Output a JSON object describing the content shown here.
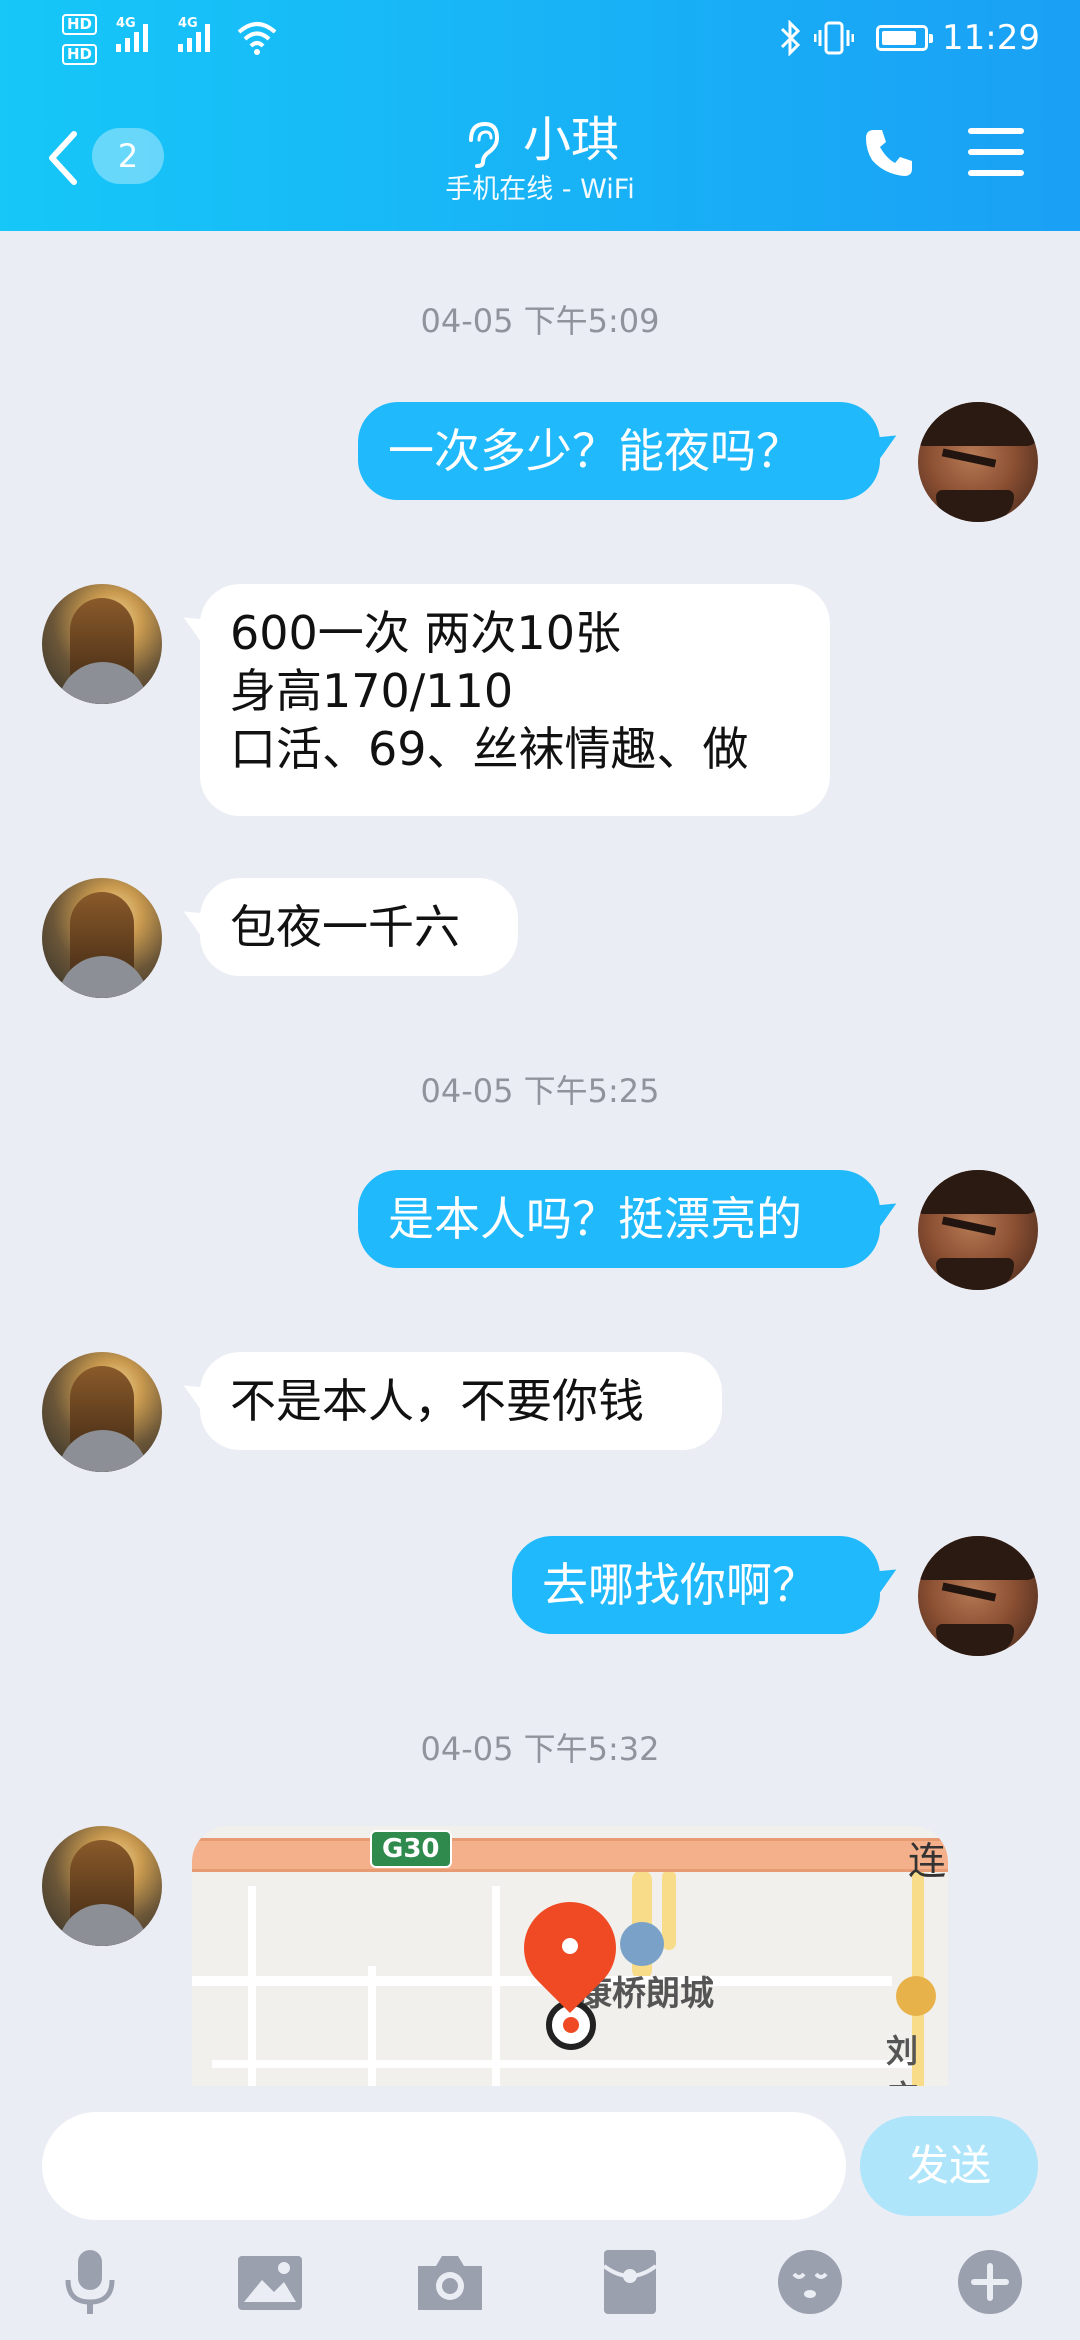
{
  "status_bar": {
    "hd1": "HD",
    "hd2": "HD",
    "network1": "4G",
    "network2": "4G",
    "time": "11:29"
  },
  "header": {
    "unread_count": "2",
    "contact_name": "小琪",
    "contact_status": "手机在线 - WiFi"
  },
  "messages": [
    {
      "type": "timestamp",
      "text": "04-05 下午5:09"
    },
    {
      "type": "out",
      "text": "一次多少？能夜吗？"
    },
    {
      "type": "in",
      "text": "600一次   两次10张\n身高170/110\n口活、69、丝袜情趣、做"
    },
    {
      "type": "in",
      "text": "包夜一千六"
    },
    {
      "type": "timestamp",
      "text": "04-05 下午5:25"
    },
    {
      "type": "out",
      "text": "是本人吗？挺漂亮的"
    },
    {
      "type": "in",
      "text": "不是本人，不要你钱"
    },
    {
      "type": "out",
      "text": "去哪找你啊？"
    },
    {
      "type": "timestamp",
      "text": "04-05 下午5:32"
    }
  ],
  "map_card": {
    "highway_label": "G30",
    "place_name": "康桥朗城",
    "edge_label_top": "连",
    "edge_label_bottom": "刘庄"
  },
  "input_bar": {
    "placeholder": "",
    "send_label": "发送",
    "tools": [
      "microphone-icon",
      "image-icon",
      "camera-icon",
      "red-packet-icon",
      "emoji-icon",
      "plus-icon"
    ]
  },
  "colors": {
    "header_gradient_start": "#16c7f8",
    "header_gradient_end": "#1aa0f5",
    "outgoing_bubble": "#20b9fb",
    "incoming_bubble": "#ffffff",
    "chat_background": "#ebedf5",
    "send_button_disabled": "#aee5fb"
  }
}
